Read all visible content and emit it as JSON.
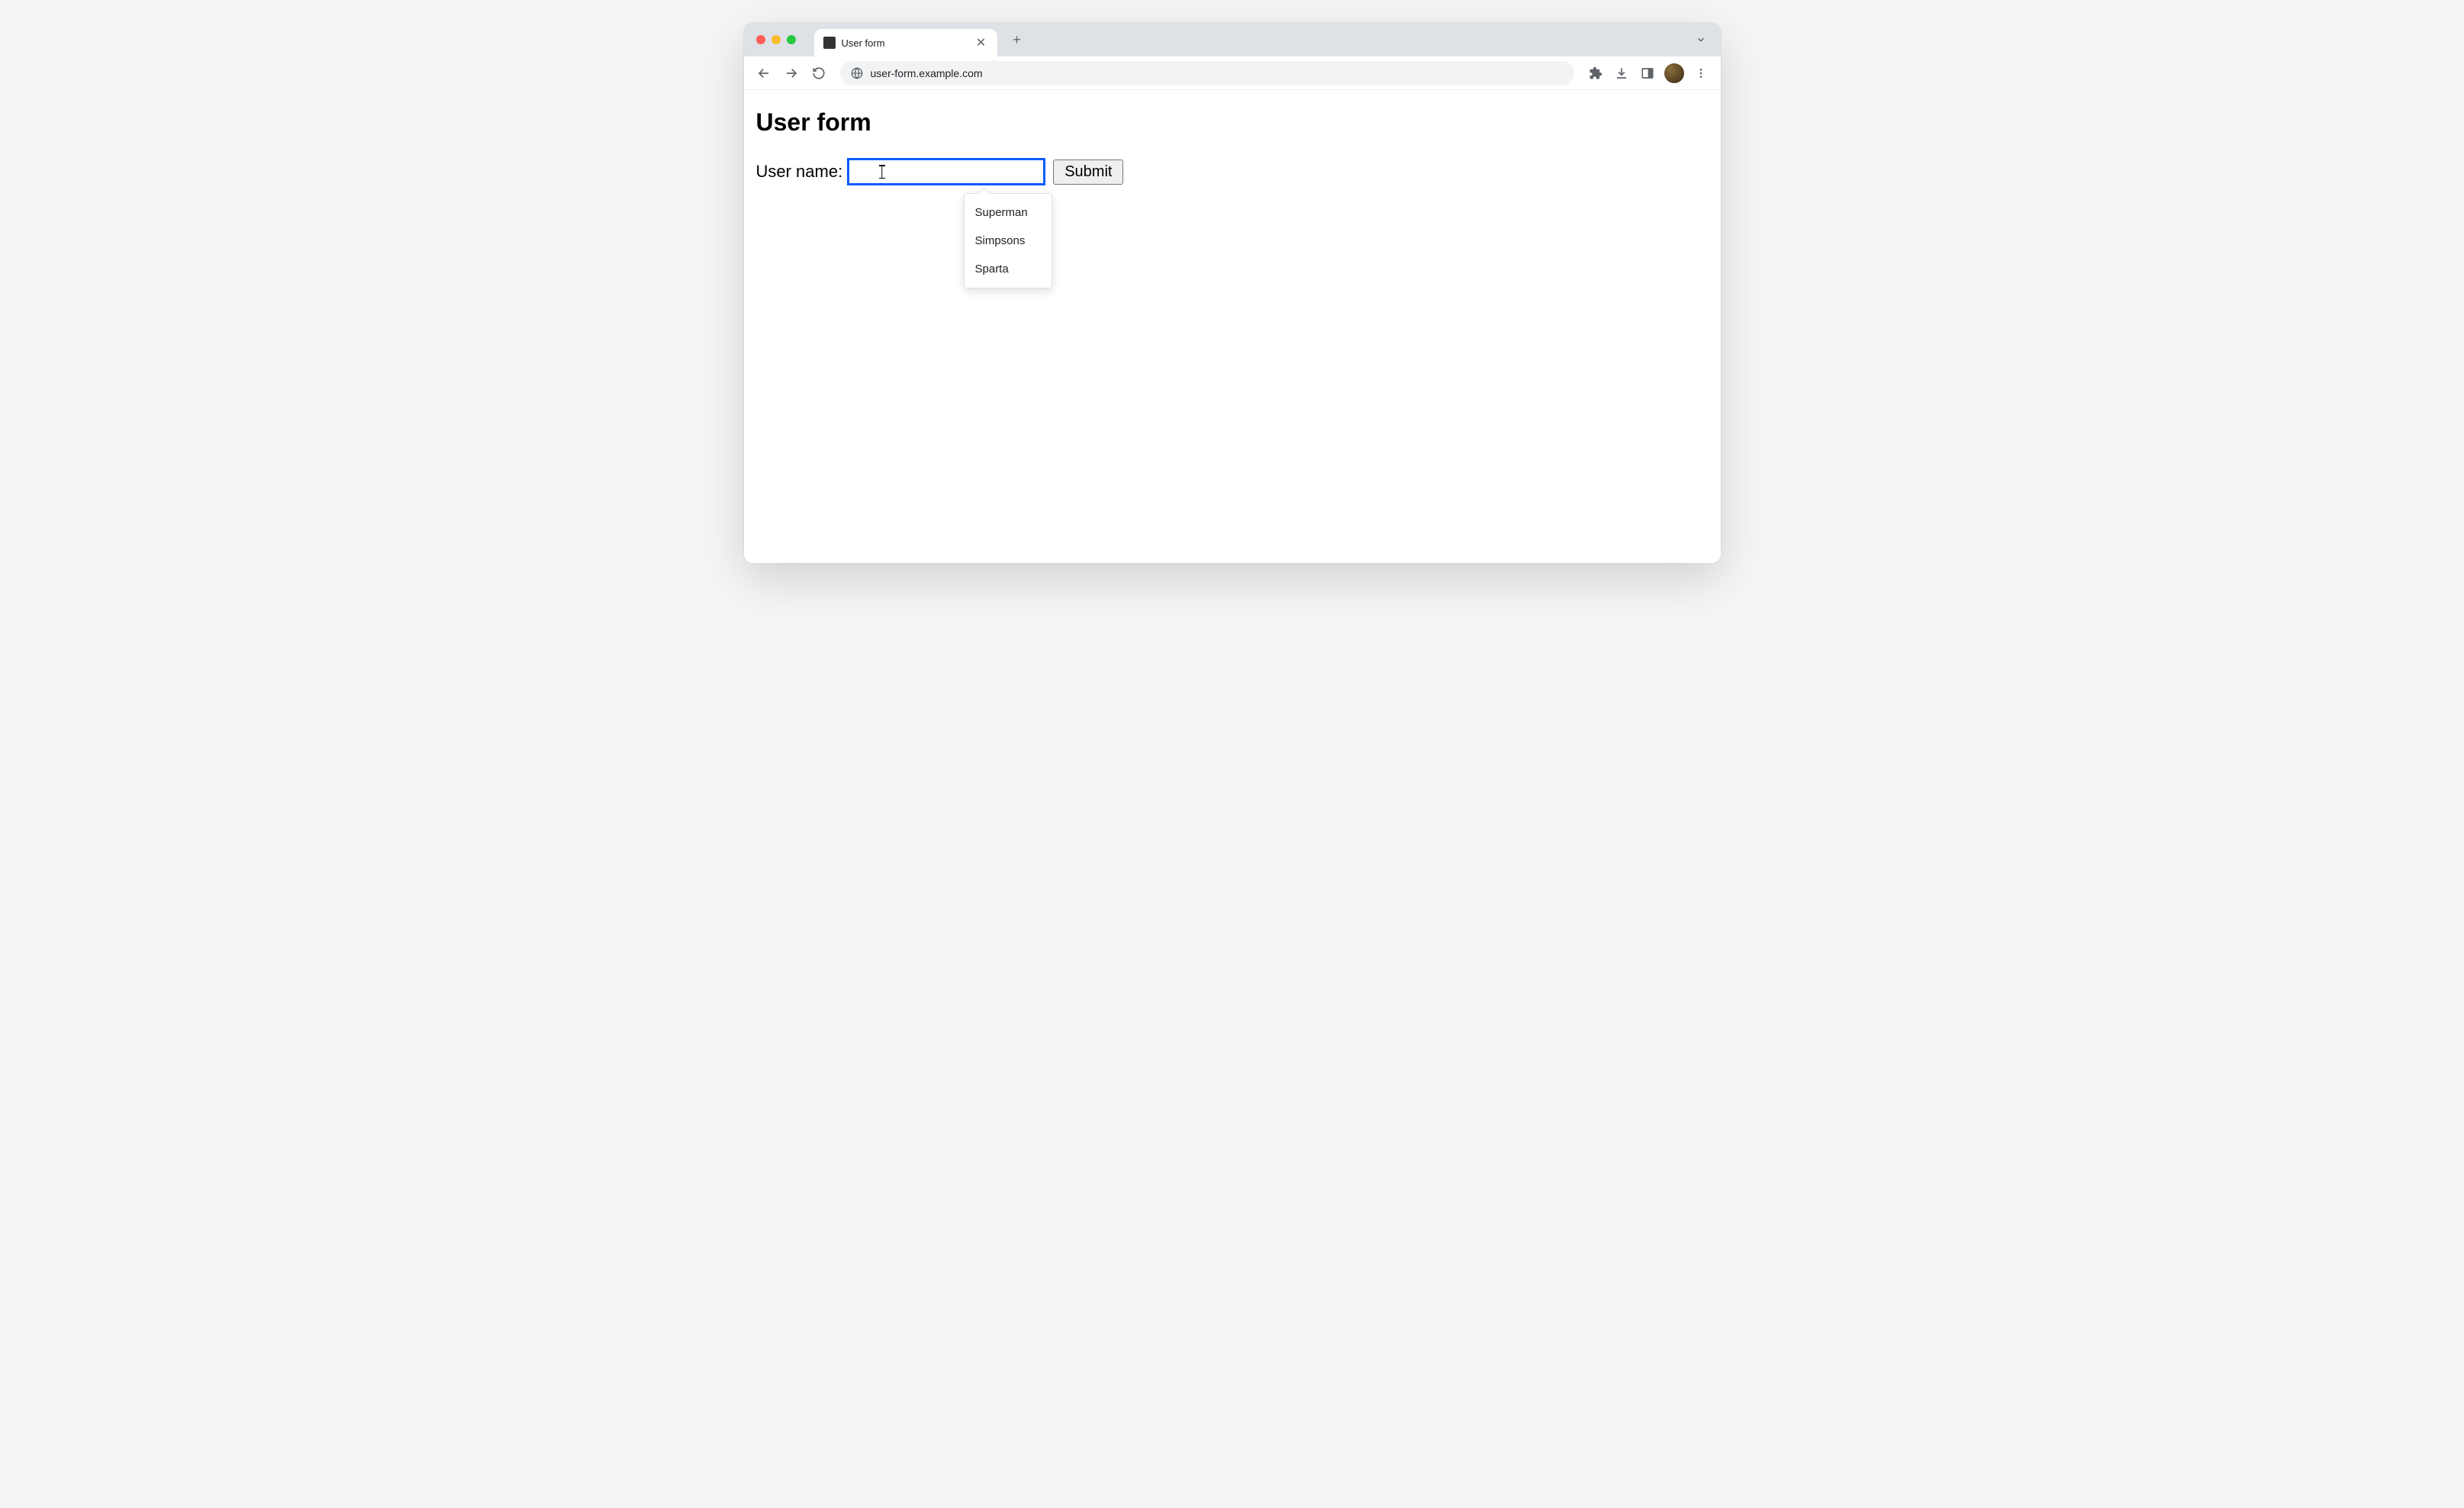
{
  "browser": {
    "tab_title": "User form",
    "url": "user-form.example.com"
  },
  "page": {
    "heading": "User form",
    "form": {
      "username_label": "User name:",
      "username_value": "",
      "submit_label": "Submit",
      "autocomplete_options": [
        "Superman",
        "Simpsons",
        "Sparta"
      ]
    }
  }
}
